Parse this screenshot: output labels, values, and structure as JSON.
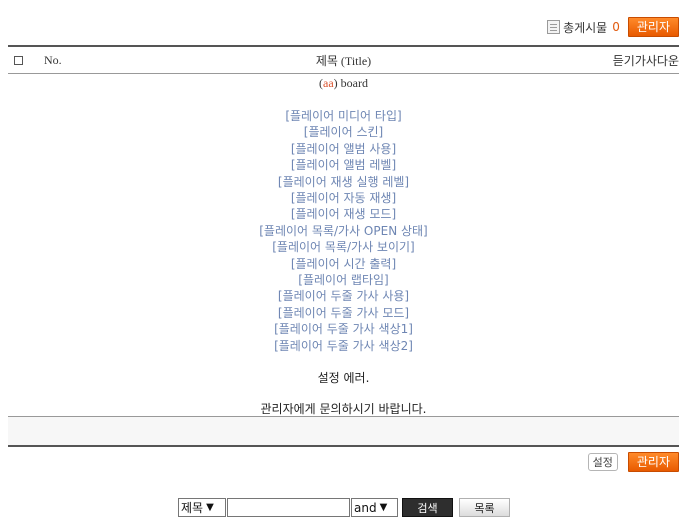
{
  "header": {
    "post_count_label": "총게시물",
    "post_count": "0",
    "admin_label": "관리자"
  },
  "table": {
    "col_no": "No.",
    "col_title": "제목 (Title)",
    "col_right": "듣기가사다운"
  },
  "board": {
    "open_paren": "(",
    "board_id": "aa",
    "suffix": ") board"
  },
  "settings": [
    "[플레이어 미디어 타입]",
    "[플레이어 스킨]",
    "[플레이어 앨범 사용]",
    "[플레이어 앨범 레벨]",
    "[플레이어 재생 실행 레벨]",
    "[플레이어 자동 재생]",
    "[플레이어 재생 모드]",
    "[플레이어 목록/가사 OPEN 상태]",
    "[플레이어 목록/가사 보이기]",
    "[플레이어 시간 출력]",
    "[플레이어 랩타임]",
    "[플레이어 두줄 가사 사용]",
    "[플레이어 두줄 가사 모드]",
    "[플레이어 두줄 가사 색상1]",
    "[플레이어 두줄 가사 색상2]"
  ],
  "error": {
    "line1": "설정 에러.",
    "line2": "관리자에게 문의하시기 바랍니다."
  },
  "footer": {
    "settings_label": "설정",
    "admin_label": "관리자"
  },
  "search": {
    "field_selected": "제목",
    "operator_selected": "and",
    "query_value": "",
    "search_label": "검색",
    "list_label": "목록"
  },
  "colors": {
    "accent": "#e85a00",
    "link": "#6e86b3",
    "board_id": "#d9512c"
  }
}
